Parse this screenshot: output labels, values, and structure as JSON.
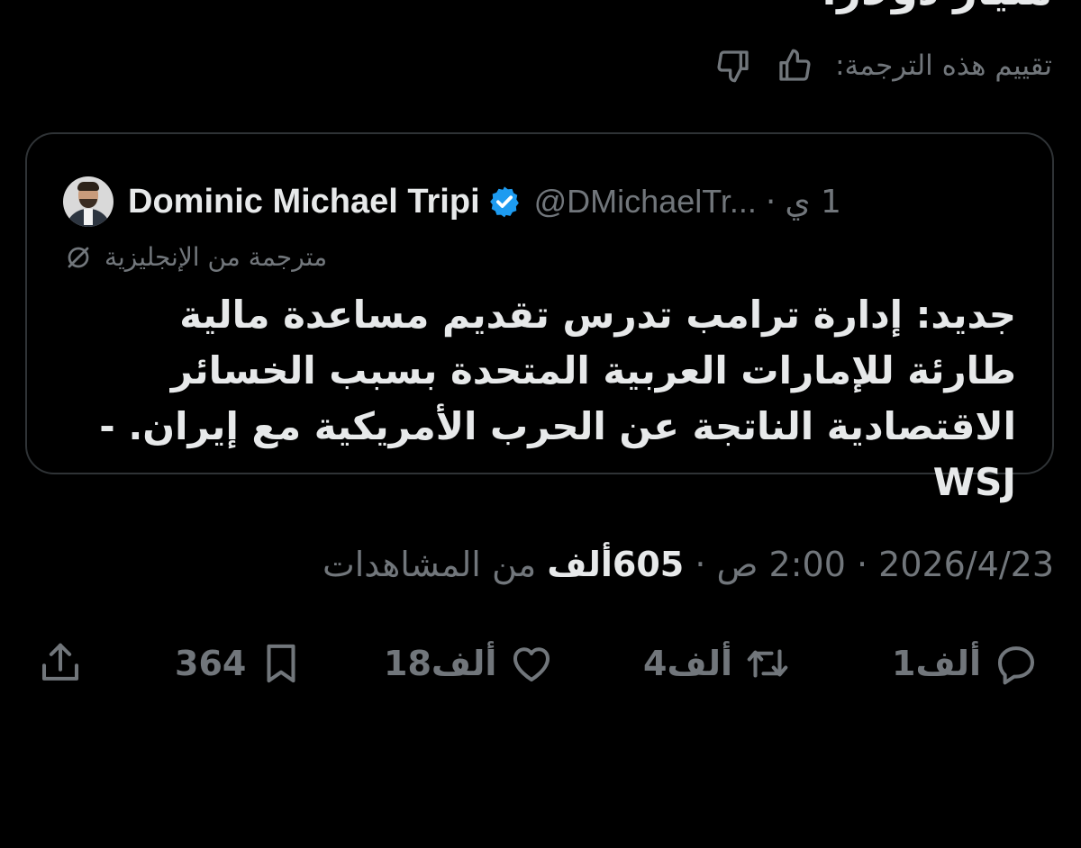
{
  "tweet": {
    "cut_text": "مليار دولار.",
    "rate_label": "تقييم هذه الترجمة:"
  },
  "quote": {
    "display_name": "Dominic Michael Tripi",
    "handle": "@DMichaelTr...",
    "separator": "·",
    "time_ago": "1 ي",
    "translated_label": "مترجمة من الإنجليزية",
    "text": "جديد: إدارة ترامب تدرس تقديم مساعدة مالية طارئة للإمارات العربية المتحدة بسبب الخسائر الاقتصادية الناتجة عن الحرب الأمريكية مع إيران. -WSJ"
  },
  "meta": {
    "date": "2026/4/23",
    "time": "2:00 ص",
    "separator": "·",
    "views_count": "605ألف",
    "views_label": "من المشاهدات"
  },
  "actions": {
    "replies": "1ألف",
    "retweets": "4ألف",
    "likes": "18ألف",
    "bookmarks": "364"
  },
  "icons": {
    "thumbs_up": "thumbs-up-icon",
    "thumbs_down": "thumbs-down-icon",
    "verified": "verified-badge-icon",
    "translate": "translate-icon",
    "reply": "reply-icon",
    "retweet": "retweet-icon",
    "like": "heart-icon",
    "bookmark": "bookmark-icon",
    "share": "share-icon"
  },
  "colors": {
    "background": "#000000",
    "text_primary": "#e7e9ea",
    "text_secondary": "#71767b",
    "border": "#2f3336",
    "verified": "#1d9bf0"
  }
}
